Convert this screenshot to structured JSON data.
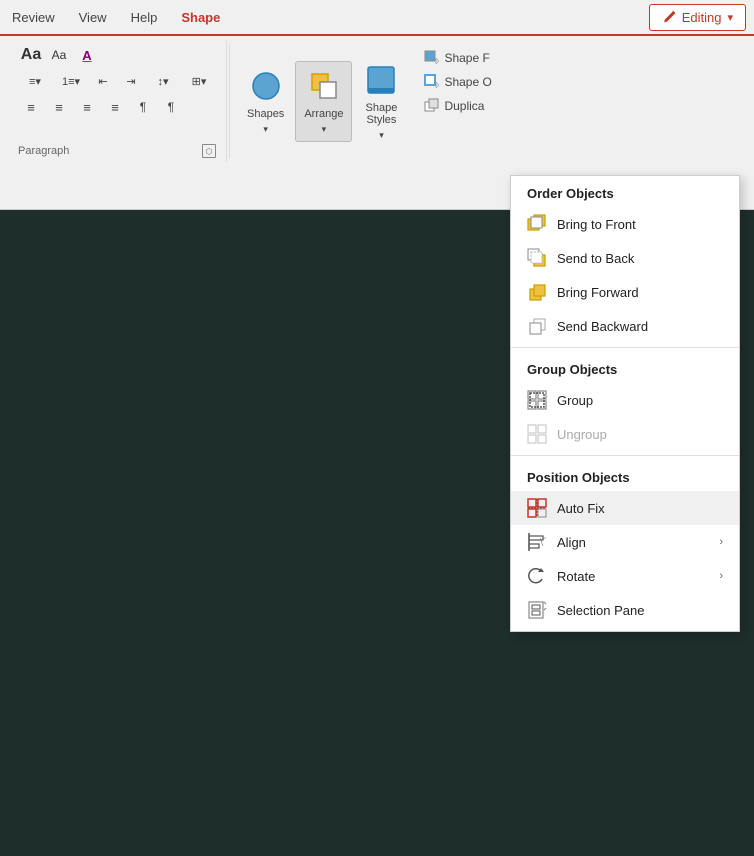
{
  "tabs": {
    "items": [
      {
        "label": "Review",
        "active": false
      },
      {
        "label": "View",
        "active": false
      },
      {
        "label": "Help",
        "active": false
      },
      {
        "label": "Shape",
        "active": true
      }
    ],
    "editing_button": "Editing",
    "editing_chevron": "▾"
  },
  "ribbon": {
    "paragraph_label": "Paragraph",
    "font_group": {
      "size_label": "Aa",
      "size2_label": "Aa",
      "color_label": "A"
    }
  },
  "shape_tools": {
    "shapes_label": "Shapes",
    "arrange_label": "Arrange",
    "style_label": "Shape\nStyles",
    "shape_fill_label": "Shape F",
    "shape_outline_label": "Shape O",
    "duplicate_label": "Duplica"
  },
  "dropdown": {
    "order_header": "Order Objects",
    "bring_front": "Bring to Front",
    "send_back": "Send to Back",
    "bring_forward": "Bring Forward",
    "send_backward": "Send Backward",
    "group_header": "Group Objects",
    "group": "Group",
    "ungroup": "Ungroup",
    "position_header": "Position Objects",
    "auto_fix": "Auto Fix",
    "align": "Align",
    "rotate": "Rotate",
    "selection_pane": "Selection Pane",
    "align_chevron": "›",
    "rotate_chevron": "›"
  },
  "colors": {
    "accent_red": "#c0392b",
    "tab_shape_color": "#c0392b",
    "dark_bg": "#1e2e2a",
    "menu_active_bg": "#f0f0f0"
  }
}
